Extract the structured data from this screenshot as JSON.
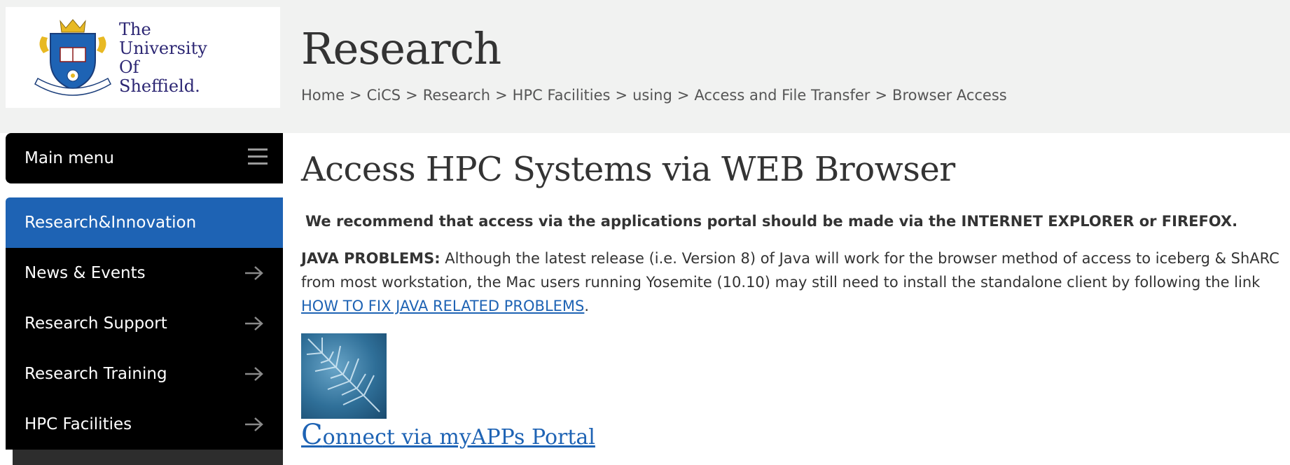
{
  "header": {
    "logo_lines": [
      "The",
      "University",
      "Of",
      "Sheffield."
    ],
    "site_title": "Research",
    "breadcrumb": [
      "Home",
      "CiCS",
      "Research",
      "HPC Facilities",
      "using",
      "Access and File Transfer",
      "Browser Access"
    ],
    "breadcrumb_separator": ">"
  },
  "sidebar": {
    "menu_label": "Main menu",
    "items": [
      {
        "label": "Research&Innovation",
        "active": true
      },
      {
        "label": "News & Events",
        "active": false
      },
      {
        "label": "Research Support",
        "active": false
      },
      {
        "label": "Research Training",
        "active": false
      },
      {
        "label": "HPC Facilities",
        "active": false
      }
    ]
  },
  "main": {
    "heading": "Access HPC Systems via WEB Browser",
    "recommendation": "We recommend that access via the applications portal should be made via the INTERNET EXPLORER or FIREFOX.",
    "java_lead": "JAVA PROBLEMS:",
    "java_text": " Although the latest release (i.e. Version 8) of Java will work for the browser method of access to iceberg & ShARC from most workstation, the Mac users running Yosemite (10.10) may still need to install the standalone client by following the link ",
    "java_link": "HOW TO FIX JAVA RELATED PROBLEMS",
    "java_end": ".",
    "portal_link_first": "C",
    "portal_link_rest": "onnect via myAPPs Portal"
  },
  "colors": {
    "accent_blue": "#1e63b4",
    "nav_black": "#000000",
    "header_bg": "#f1f2f1",
    "logo_navy": "#2c2673"
  },
  "icons": [
    "university-crest-logo",
    "hamburger-icon",
    "arrow-right-icon",
    "ice-crystal-thumbnail"
  ]
}
